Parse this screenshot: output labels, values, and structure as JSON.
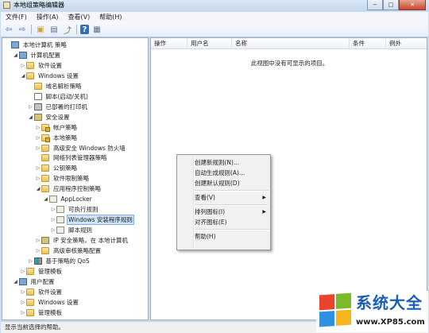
{
  "window": {
    "title": "本地组策略编辑器",
    "buttons": {
      "minimize": "−",
      "maximize": "□",
      "close": "✕"
    }
  },
  "menubar": [
    "文件(F)",
    "操作(A)",
    "查看(V)",
    "帮助(H)"
  ],
  "toolbar": [
    {
      "icon": "back-arrow-icon",
      "glyph": "⇦",
      "color": "#2f6fb5"
    },
    {
      "icon": "forward-arrow-icon",
      "glyph": "⇨",
      "color": "#2f6fb5"
    },
    {
      "icon": "up-folder-icon",
      "glyph": "▣",
      "color": "#c9a23b"
    },
    {
      "icon": "show-hide-tree-icon",
      "glyph": "▤",
      "color": "#5a6f8c"
    },
    {
      "icon": "export-list-icon",
      "glyph": "⤴",
      "color": "#4b8a3a"
    },
    {
      "icon": "help-icon",
      "glyph": "?",
      "color": "#2f6fb5"
    },
    {
      "icon": "properties-icon",
      "glyph": "▦",
      "color": "#5a6f8c"
    }
  ],
  "tree": [
    {
      "label": "本地计算机 策略",
      "level": 0,
      "arrow": "",
      "icon": "computer",
      "name": "local-computer-policy"
    },
    {
      "label": "计算机配置",
      "level": 1,
      "arrow": "◢",
      "icon": "computer",
      "name": "computer-configuration"
    },
    {
      "label": "软件设置",
      "level": 2,
      "arrow": "▷",
      "icon": "folder",
      "name": "software-settings"
    },
    {
      "label": "Windows 设置",
      "level": 2,
      "arrow": "◢",
      "icon": "folder",
      "name": "windows-settings"
    },
    {
      "label": "域名解析策略",
      "level": 3,
      "arrow": "",
      "icon": "folder",
      "name": "name-resolution-policy"
    },
    {
      "label": "脚本(启动/关机)",
      "level": 3,
      "arrow": "",
      "icon": "script",
      "name": "scripts-startup-shutdown"
    },
    {
      "label": "已部署的打印机",
      "level": 3,
      "arrow": "▷",
      "icon": "printer",
      "name": "deployed-printers"
    },
    {
      "label": "安全设置",
      "level": 3,
      "arrow": "◢",
      "icon": "shield",
      "name": "security-settings"
    },
    {
      "label": "帐户策略",
      "level": 4,
      "arrow": "▷",
      "icon": "folder-lock",
      "name": "account-policies"
    },
    {
      "label": "本地策略",
      "level": 4,
      "arrow": "▷",
      "icon": "folder-lock",
      "name": "local-policies"
    },
    {
      "label": "高级安全 Windows 防火墙",
      "level": 4,
      "arrow": "▷",
      "icon": "folder",
      "name": "advanced-firewall"
    },
    {
      "label": "网络列表管理器策略",
      "level": 4,
      "arrow": "",
      "icon": "folder",
      "name": "network-list-manager-policies"
    },
    {
      "label": "公钥策略",
      "level": 4,
      "arrow": "▷",
      "icon": "folder",
      "name": "public-key-policies"
    },
    {
      "label": "软件限制策略",
      "level": 4,
      "arrow": "▷",
      "icon": "folder",
      "name": "software-restriction-policies"
    },
    {
      "label": "应用程序控制策略",
      "level": 4,
      "arrow": "◢",
      "icon": "folder",
      "name": "application-control-policies"
    },
    {
      "label": "AppLocker",
      "level": 5,
      "arrow": "◢",
      "icon": "policy",
      "name": "applocker"
    },
    {
      "label": "可执行规则",
      "level": 6,
      "arrow": "▷",
      "icon": "policy",
      "name": "executable-rules"
    },
    {
      "label": "Windows 安装程序规则",
      "level": 6,
      "arrow": "▷",
      "icon": "policy",
      "name": "windows-installer-rules",
      "selected": true
    },
    {
      "label": "脚本规则",
      "level": 6,
      "arrow": "▷",
      "icon": "policy",
      "name": "script-rules"
    },
    {
      "label": "IP 安全策略，在 本地计算机",
      "level": 4,
      "arrow": "▷",
      "icon": "shield",
      "name": "ip-security-policies"
    },
    {
      "label": "高级审核策略配置",
      "level": 4,
      "arrow": "▷",
      "icon": "folder",
      "name": "advanced-audit-policy"
    },
    {
      "label": "基于策略的 QoS",
      "level": 3,
      "arrow": "▷",
      "icon": "chart",
      "name": "policy-based-qos"
    },
    {
      "label": "管理模板",
      "level": 2,
      "arrow": "▷",
      "icon": "folder",
      "name": "administrative-templates-computer"
    },
    {
      "label": "用户配置",
      "level": 1,
      "arrow": "◢",
      "icon": "computer",
      "name": "user-configuration"
    },
    {
      "label": "软件设置",
      "level": 2,
      "arrow": "▷",
      "icon": "folder",
      "name": "user-software-settings"
    },
    {
      "label": "Windows 设置",
      "level": 2,
      "arrow": "▷",
      "icon": "folder",
      "name": "user-windows-settings"
    },
    {
      "label": "管理模板",
      "level": 2,
      "arrow": "▷",
      "icon": "folder",
      "name": "administrative-templates-user"
    }
  ],
  "list": {
    "columns": [
      "操作",
      "用户名",
      "名称",
      "条件",
      "例外"
    ],
    "empty_message": "此视图中没有可显示的项目。"
  },
  "context_menu": [
    {
      "label": "创建新规则(N)...",
      "name": "create-new-rule"
    },
    {
      "label": "自动生成规则(A)...",
      "name": "auto-generate-rules"
    },
    {
      "label": "创建默认规则(D)",
      "name": "create-default-rules"
    },
    {
      "sep": true
    },
    {
      "label": "查看(V)",
      "name": "view-submenu",
      "submenu": true
    },
    {
      "sep": true
    },
    {
      "label": "排列图标(I)",
      "name": "arrange-icons-submenu",
      "submenu": true
    },
    {
      "label": "对齐图标(E)",
      "name": "line-up-icons"
    },
    {
      "sep": true
    },
    {
      "label": "帮助(H)",
      "name": "help"
    }
  ],
  "statusbar": {
    "text": "显示当前选择的帮助。"
  },
  "watermark": {
    "text": "系统大全",
    "url": "www.XP85.com",
    "logo_colors": [
      "#e8452c",
      "#7cba2a",
      "#2f8fe0",
      "#f6b51e"
    ]
  }
}
